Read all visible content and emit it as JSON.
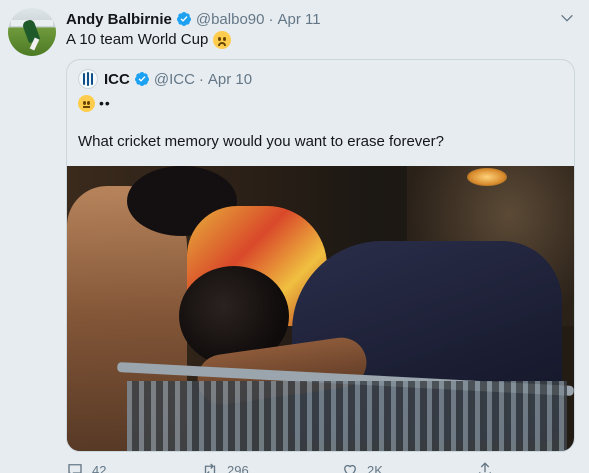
{
  "tweet": {
    "author_name": "Andy Balbirnie",
    "handle": "@balbo90",
    "separator": "·",
    "date": "Apr 11",
    "text": "A 10 team World Cup",
    "text_emoji": "frowning-face",
    "colors": {
      "handle": "#657786",
      "background": "#e6ecf0"
    }
  },
  "quoted": {
    "author_name": "ICC",
    "handle": "@ICC",
    "separator": "·",
    "date": "Apr 10",
    "line1_emoji": "neutral-face",
    "line1_suffix": "••",
    "text": "What cricket memory would you want to erase forever?"
  },
  "actions": {
    "reply_count": "42",
    "retweet_count": "296",
    "like_count": "2K"
  }
}
